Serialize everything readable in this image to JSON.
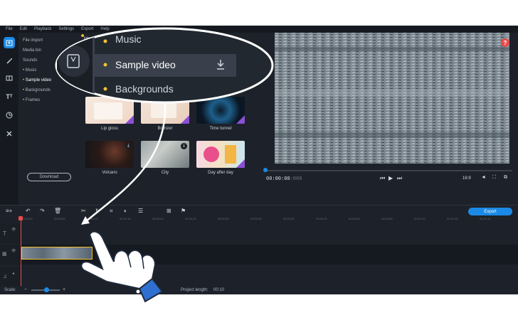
{
  "menu": [
    "File",
    "Edit",
    "Playback",
    "Settings",
    "Export",
    "Help"
  ],
  "nav": {
    "items": [
      "File import",
      "Media bin",
      "Sounds",
      "Music",
      "Sample video",
      "Backgrounds",
      "Frames"
    ],
    "active": "Sample video",
    "download_label": "Download"
  },
  "library": {
    "header_partial": "Mo",
    "thumbnails": [
      {
        "label": "Lip gloss",
        "has_download": false
      },
      {
        "label": "Bronzer",
        "has_download": false
      },
      {
        "label": "Time tunnel",
        "has_download": false
      },
      {
        "label": "Volcano",
        "has_download": true
      },
      {
        "label": "City",
        "has_download": true
      },
      {
        "label": "Day after day",
        "has_download": false
      }
    ]
  },
  "callout": {
    "items": [
      "Music",
      "Sample video",
      "Backgrounds"
    ],
    "highlighted": "Sample video"
  },
  "player": {
    "timecode_main": "00:00:00",
    "timecode_frames": ":000",
    "aspect": "16:9",
    "help_label": "?"
  },
  "timeline": {
    "export_label": "Export",
    "ruler": [
      "00:00:00",
      "00:00:05",
      "00:00:10",
      "00:00:15",
      "00:00:20",
      "00:00:25",
      "00:00:30",
      "00:00:35",
      "00:00:40",
      "00:00:45",
      "00:00:50",
      "00:00:55",
      "00:01:00",
      "00:01:05",
      "00:01:10",
      "00:01:15"
    ]
  },
  "status": {
    "scale_label": "Scale:",
    "project_length_label": "Project length:",
    "project_length_value": "00:10"
  },
  "colors": {
    "accent": "#1b8ae6",
    "background": "#1d222a",
    "playhead": "#e84b4b",
    "clip_border": "#f2c12e",
    "bullet": "#f2c12e"
  },
  "icons": [
    "import-icon",
    "magic-wand-icon",
    "transitions-icon",
    "titles-icon",
    "stickers-icon",
    "tools-icon",
    "undo-icon",
    "redo-icon",
    "delete-icon",
    "cut-icon",
    "rotate-icon",
    "crop-icon",
    "color-icon",
    "properties-icon",
    "marker-icon",
    "flag-icon",
    "play-icon",
    "prev-icon",
    "next-icon",
    "volume-icon",
    "fullscreen-icon",
    "hand-pointer-icon"
  ]
}
